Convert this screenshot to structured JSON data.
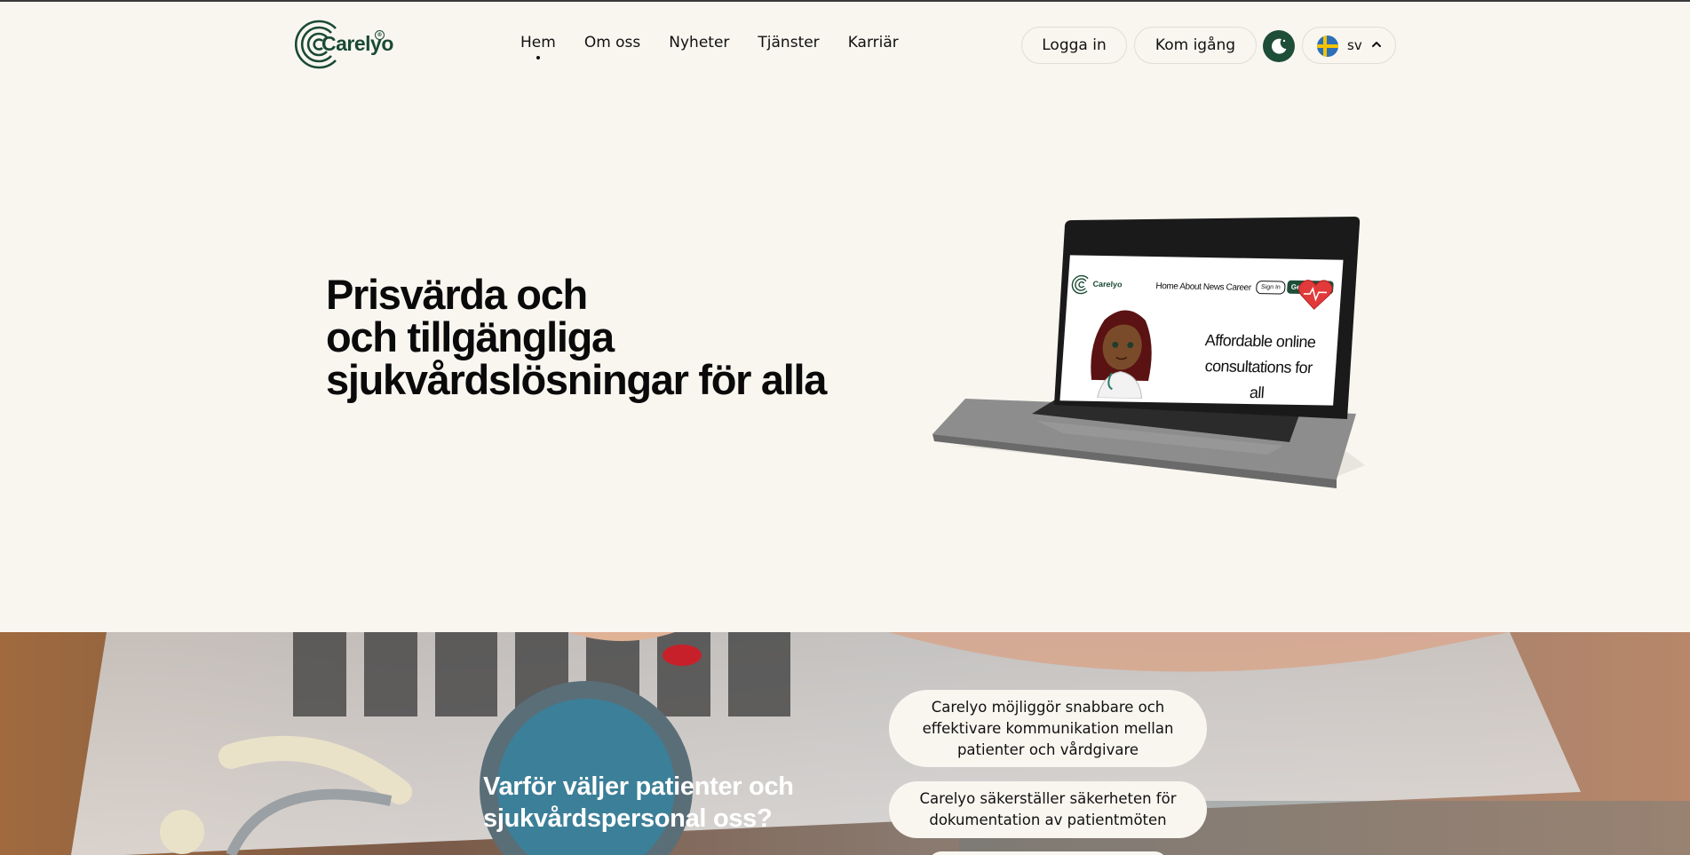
{
  "brand": {
    "name": "Carelyo",
    "reg_mark": "®"
  },
  "nav": {
    "items": [
      {
        "label": "Hem",
        "active": true
      },
      {
        "label": "Om oss"
      },
      {
        "label": "Nyheter"
      },
      {
        "label": "Tjänster"
      },
      {
        "label": "Karriär"
      }
    ]
  },
  "header": {
    "login_label": "Logga in",
    "get_started_label": "Kom igång",
    "theme_icon": "moon-icon",
    "language": {
      "code": "sv",
      "flag": "sweden-flag-icon"
    }
  },
  "hero": {
    "title_lines": [
      "Prisvärda och",
      "och tillgängliga",
      "sjukvårdslösningar för alla"
    ],
    "mockup": {
      "logo": "Carelyo",
      "nav": "Home About News Career",
      "sign_in": "Sign In",
      "get_started": "Get Started",
      "tagline": "Affordable online consultations for all"
    }
  },
  "why": {
    "title": "Varför väljer patienter och sjukvårdspersonal oss?",
    "points": [
      "Carelyo möjliggör snabbare och effektivare kommunikation mellan patienter och vårdgivare",
      "Carelyo säkerställer säkerheten för dokumentation av patientmöten"
    ]
  },
  "colors": {
    "brand_green": "#1e4d38",
    "background": "#f9f6f0"
  }
}
